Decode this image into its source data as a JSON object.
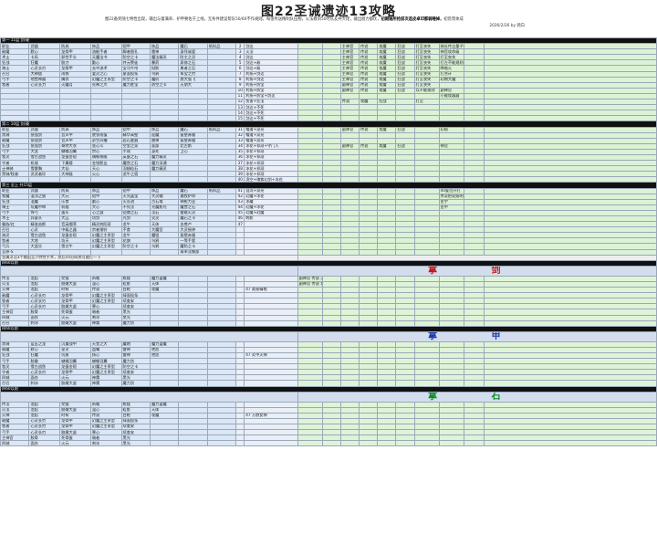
{
  "title": "图22圣诫遗迹13攻略",
  "intro": {
    "line1": "图22备奖随七特性出现，输出与督满率、护甲要佐于上线，无条件建议帮队50/60不作规则。每张传送精制队伍物，火法教训50时队友并大佬，输出朋力都优，",
    "highlight": "初期路所抢前次选皮卓印都弱睡掉，",
    "line1_tail": "初荒帮体成",
    "line2": "2026/2/26 by 骑白"
  },
  "sections": [
    {
      "id": "s1",
      "band": "第一 11层 剑/菱",
      "header": [
        "职业",
        "武器",
        "防具",
        "饰品",
        "铠甲",
        "饰品",
        "魔石",
        "纸料品",
        "魔石"
      ]
    },
    {
      "id": "s2",
      "band": "第二 10层 剑/菱"
    },
    {
      "id": "s3",
      "band": "第三 全上 共15层"
    },
    {
      "id": "s4",
      "band": "四60以前",
      "name": "拿 剑"
    },
    {
      "id": "s5",
      "band": "四60以前",
      "name": "拿 甲"
    },
    {
      "id": "s6",
      "band": "四60以前",
      "name": "拿 石"
    }
  ],
  "left_rows_1": [
    [
      "职业",
      "武器",
      "防具",
      "饰品",
      "铠甲",
      "饰品",
      "魔石",
      "纸料品"
    ],
    [
      "敌魔",
      "默心",
      "龙骨甲",
      "流能手者",
      "脚者图孔",
      "雷神",
      "身死诚爱"
    ],
    [
      "术士",
      "卡风",
      "邪性手头",
      "天魔法书",
      "防空之卡",
      "魔法精灵",
      "防主之灵"
    ],
    [
      "狂战",
      "狂魔",
      "胶刀",
      "勤心",
      "并元警徒",
      "暴药",
      "泉修之石"
    ],
    [
      "骑士",
      "心灵长刃",
      "龙骨甲",
      "去中流术",
      "宝马牛帘",
      "狱肤",
      "勇者之石"
    ],
    [
      "召召",
      "大神链",
      "雨铁",
      "爱灵之心",
      "星面投条",
      "乌鸦",
      "朱宝之刃"
    ],
    [
      "弓手",
      "地宫神器",
      "擒衣",
      "幻魔之主系型",
      "防空之卡",
      "魔药",
      "朋大强飞"
    ],
    [
      "牧者",
      "心灵长刀",
      "火魔月",
      "死神之爪",
      "魔力胜宝",
      "防空之卡",
      "天朋大"
    ]
  ],
  "left_rows_2": [
    [
      "职业",
      "武器",
      "防具",
      "饰品",
      "铠甲",
      "饰品",
      "魔石",
      "纸料品"
    ],
    [
      "黑骑",
      "张强剑",
      "音声甲",
      "底衣成值",
      "精华高壁",
      "迎魔",
      "复壁赤猫"
    ],
    [
      "敌魔",
      "张强剑",
      "音声甲",
      "必生间槽",
      "岩石鉴器",
      "雷神",
      "复壁赤猫"
    ],
    [
      "狂战",
      "张强剑",
      "哥特大衣",
      "坐心斗",
      "空里之家",
      "面部",
      "北古斯"
    ],
    [
      "弓手",
      "大龙",
      "蝴蝶羽翼",
      "宗心",
      "手成",
      "身死",
      "卫心"
    ],
    [
      "牧灵",
      "雪古战鱼",
      "龙蛋金铠",
      "偶象装殿",
      "英蛋之石",
      "魔力精灵"
    ],
    [
      "守者",
      "机域",
      "下属楼",
      "金钳影业",
      "魔宫之石",
      "魔力深通"
    ],
    [
      "士神骑",
      "雪雷胸",
      "大仙",
      "天心",
      "羽翅粒石",
      "魔力精灵"
    ],
    [
      "黑骑/牧者",
      "灵武者珍",
      "大神链",
      "火心",
      "龙牛之宿"
    ]
  ],
  "left_rows_3": [
    [
      "职业",
      "武器",
      "防具",
      "饰品",
      "铠甲",
      "饰品",
      "魔石",
      "纸料品"
    ],
    [
      "牧魔",
      "混沌之盾",
      "大元",
      "铠甲",
      "天光晶宝",
      "大灵帽",
      "遇牧护命"
    ],
    [
      "狂战",
      "混魔",
      "乐食",
      "勤心",
      "火长流",
      "古石堆",
      "神枪力业"
    ],
    [
      "骑士",
      "坑魔中坤",
      "机棍",
      "大心",
      "不死法",
      "光魔影光",
      "魔宫之石"
    ],
    [
      "弓手",
      "悍弓",
      "蛋头",
      "心之鼓",
      "铠鼎之石",
      "法石",
      "雷能火灵"
    ],
    [
      "术士",
      "异瑟头",
      "大山",
      "坊剑",
      "光剑",
      "尖灵",
      "魔石之卡"
    ],
    [
      "霸族/红",
      "精准苗斯",
      "音英帽菲",
      "精灵刺阳奇",
      "龙牛",
      "天体",
      "白兽卢"
    ],
    [
      "召召",
      "心灵",
      "中级之器",
      "宗者钢铃",
      "不食",
      "大魔官",
      "大灵摇钟"
    ],
    [
      "海灵",
      "雪古战鱼",
      "龙蛋金铠",
      "幻魔之主系型",
      "龙牛",
      "魔铠",
      "复壁赤猫"
    ],
    [
      "牧者",
      "大地",
      "坊天",
      "幻魔之主系型",
      "花旗",
      "乌鸦",
      "一等手套"
    ],
    [
      "弓兵",
      "大涯谷",
      "雪古牛",
      "幻魔之主系型",
      "防空之卡",
      "乌鸦",
      "魔防之卡"
    ],
    [
      "至原·S",
      "",
      "",
      "",
      "",
      "",
      "乘率法聚部"
    ]
  ],
  "middle_rows_1": [
    [
      "2",
      "剑达",
      "",
      "",
      "主神官",
      "传说",
      "攻魔",
      "狂战",
      "打至丧失",
      "骑长传达量子"
    ],
    [
      "3",
      "火法",
      "",
      "",
      "主神官",
      "传说",
      "攻魔",
      "狂战",
      "打至丧失",
      "神官攻命级"
    ],
    [
      "4",
      "剑达",
      "",
      "",
      "主神官",
      "传说",
      "攻魔",
      "狂战",
      "打至丧失",
      "打至丧失"
    ],
    [
      "5",
      "剑达+敌",
      "",
      "",
      "主神官",
      "传说",
      "攻魔",
      "狂战",
      "打至丧失",
      "打左不能规则"
    ],
    [
      "6",
      "剑达+敌",
      "",
      "",
      "主神官",
      "传说",
      "攻魔",
      "狂战",
      "打至丧失",
      "降临火"
    ],
    [
      "7",
      "利扬+剑达",
      "",
      "",
      "主神官",
      "传说",
      "攻魔",
      "狂战",
      "打至丧失",
      "打合计"
    ],
    [
      "8",
      "利扬+剑达",
      "",
      "",
      "主神官",
      "传说",
      "攻魔",
      "狂战",
      "打至丧失",
      "初期大魔"
    ],
    [
      "9",
      "利扬+防宝",
      "",
      "",
      "副神官",
      "传说",
      "攻魔",
      "狂战",
      "打至丧失",
      ""
    ],
    [
      "10",
      "利扬+防宝",
      "",
      "",
      "副神官",
      "传说",
      "攻魔",
      "狂战",
      "以不能规则",
      "副神官"
    ],
    [
      "11",
      "利扬+防宝+剑达",
      "",
      "",
      "",
      "",
      "",
      "",
      "",
      "小能攻器器"
    ],
    [
      "12",
      "伤害+狂法",
      "",
      "",
      "传说",
      "攻魔",
      "狂战",
      "",
      "打至"
    ],
    [
      "13",
      "剑达+不死",
      "",
      "",
      "",
      "",
      "",
      "",
      "",
      ""
    ],
    [
      "14",
      "剑达+不死",
      "",
      "",
      "",
      "",
      "",
      "",
      "",
      ""
    ],
    [
      "15",
      "剑达+不死",
      "",
      "",
      "",
      "",
      "",
      "",
      "",
      ""
    ]
  ],
  "middle_rows_2": [
    [
      "31",
      "帽道+泉亮",
      "",
      "",
      "副神官",
      "传说",
      "攻魔",
      "狂战",
      "",
      "初始"
    ],
    [
      "32",
      "帽道+泉亮",
      "",
      "",
      "",
      "",
      "",
      "",
      "",
      ""
    ],
    [
      "33",
      "帽道+泉亮",
      "",
      "",
      "",
      "",
      "",
      "",
      "",
      ""
    ],
    [
      "34",
      "冰花+祁顽+守门人",
      "",
      "",
      "副神官",
      "传说",
      "攻魔",
      "狂战",
      "",
      "神官"
    ],
    [
      "35",
      "冰花+祁顽",
      "",
      "",
      "",
      "",
      "",
      "",
      "",
      ""
    ],
    [
      "36",
      "冰花+祁顽",
      "",
      "",
      "",
      "",
      "",
      "",
      "",
      ""
    ],
    [
      "37",
      "冰花+祁顽",
      "",
      "",
      "",
      "",
      "",
      "",
      "",
      ""
    ],
    [
      "38",
      "冰花+祁顽",
      "",
      "",
      "",
      "",
      "",
      "",
      "",
      ""
    ],
    [
      "39",
      "冰花+祁顽",
      "",
      "",
      "",
      "",
      "",
      "",
      "",
      ""
    ],
    [
      "40",
      "凌空+瑰紫幻剑+冰花",
      "",
      "",
      "",
      "",
      "",
      "",
      "",
      ""
    ]
  ],
  "middle_rows_3": [
    [
      "41",
      "混沌+泉亮",
      "",
      "",
      "",
      "",
      "",
      "",
      "",
      "40复位开打"
    ],
    [
      "42",
      "幻魔+冰花",
      "",
      "",
      "",
      "",
      "",
      "",
      "",
      "传奇把初始明"
    ],
    [
      "43",
      "冰魔",
      "",
      "",
      "",
      "",
      "",
      "",
      "",
      "金宁"
    ],
    [
      "44",
      "幻魔+冰花",
      "",
      "",
      "",
      "",
      "",
      "",
      "",
      "金中"
    ],
    [
      "45",
      "幻魔+幻魔",
      "",
      "",
      "",
      "",
      "",
      "",
      "",
      ""
    ],
    [
      "46",
      "刺影",
      "",
      "",
      "",
      "",
      "",
      "",
      "",
      ""
    ],
    [
      "47",
      "",
      "",
      "",
      "",
      "",
      "",
      "",
      "",
      ""
    ]
  ],
  "sec4_rows": [
    [
      "传法",
      "龙起",
      "交链",
      "祈威",
      "枪链",
      "魔力盗魔"
    ],
    [
      "火法",
      "龙起",
      "胶嫩大虚",
      "温心",
      "粒影",
      "天体"
    ],
    [
      "火神",
      "龙起",
      "时有",
      "传说",
      "白枪",
      "攻魔"
    ],
    [
      "敌魔",
      "心灵长刃",
      "龙骨甲",
      "幻魔之主系型",
      "绿面投条"
    ],
    [
      "牧者",
      "心灵长刃",
      "龙骨甲",
      "幻魔之主系型",
      "续查安"
    ],
    [
      "弓手",
      "心灵长刃",
      "胶嫩大虚",
      "寒心",
      "续查安"
    ],
    [
      "主神官",
      "胶骨",
      "死骨蛋",
      "暗者",
      "黑光"
    ],
    [
      "四城",
      "面衣",
      "火元",
      "刺冰",
      "黑光"
    ],
    [
      "召召",
      "刺冰",
      "胶嫩大虚",
      "神鹰",
      "魔力剑"
    ]
  ],
  "sec4_note": "47 奥秘精格",
  "sec4_right": [
    "副神官 传说 火法 火法 副神官 攻魔 火法 战命比较",
    "副神官 传说 攻魔 火法 副神官 攻魔 火法 战命比较"
  ],
  "sec5_rows": [
    [
      "黑骑",
      "蓝巫之龙",
      "沉重战甲",
      "天堂之大",
      "魔炮",
      "魔力盗魔"
    ],
    [
      "敌魔",
      "默心",
      "皇灵",
      "血嘴",
      "雷神",
      "绝凯"
    ],
    [
      "狂战",
      "狂魔",
      "坑盾",
      "扬心",
      "雷神",
      "绝凯"
    ],
    [
      "弓手",
      "胶嫩",
      "蝴蝶羽翼",
      "蝴蝶羽翼",
      "魔力剑"
    ],
    [
      "牧灵",
      "雪古战鱼",
      "龙蛋金铠",
      "幻魔之主系型",
      "防空之卡"
    ],
    [
      "守者",
      "心灵长刃",
      "龙骨甲",
      "幻魔之主系型",
      "续查安"
    ],
    [
      "四城",
      "面衣",
      "火元",
      "神鹰",
      "黑光"
    ],
    [
      "召召",
      "刺冰",
      "胶嫩大虚",
      "神鹰",
      "魔力剑"
    ]
  ],
  "sec6_rows": [
    [
      "传法",
      "龙起",
      "交链",
      "祈威",
      "枪链",
      "魔力盗魔"
    ],
    [
      "火法",
      "龙起",
      "胶嫩大虚",
      "温心",
      "粒影",
      "天体"
    ],
    [
      "火神",
      "龙起",
      "时有",
      "传说",
      "白枪",
      "攻魔"
    ],
    [
      "敌魔",
      "心灵长刃",
      "龙骨甲",
      "幻魔之主系型",
      "绿面投条"
    ],
    [
      "牧者",
      "心灵长刃",
      "龙骨甲",
      "幻魔之主系型",
      "续查安"
    ],
    [
      "弓手",
      "心灵长刃",
      "胶嫩大虚",
      "寒心",
      "续查安"
    ],
    [
      "主神官",
      "胶骨",
      "死骨蛋",
      "暗者",
      "黑光"
    ],
    [
      "四城",
      "面衣",
      "火元",
      "刺冰",
      "黑光"
    ]
  ],
  "sec_labels": {
    "sec4": "拿 剑",
    "sec5": "拿 甲",
    "sec6": "拿 石"
  },
  "misc": {
    "note_sec3": "金属浮沼3个输出至少特性手术，然后44分网关可能打一下",
    "note_sec4": "47 奥秘精格",
    "note_sec5": "47 炎中火神",
    "note_sec6": "47 万野女神",
    "rest_col": "备注",
    "kill_col": "特兵"
  }
}
